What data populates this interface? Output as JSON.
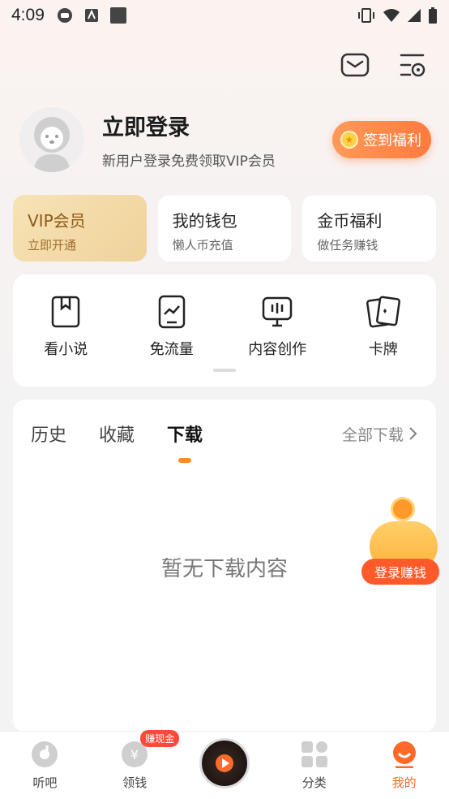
{
  "status": {
    "time": "4:09"
  },
  "profile": {
    "title": "立即登录",
    "subtitle": "新用户登录免费领取VIP会员",
    "checkin_label": "签到福利"
  },
  "cards": [
    {
      "title": "VIP会员",
      "sub": "立即开通"
    },
    {
      "title": "我的钱包",
      "sub": "懒人币充值"
    },
    {
      "title": "金币福利",
      "sub": "做任务赚钱"
    }
  ],
  "tools": [
    {
      "label": "看小说"
    },
    {
      "label": "免流量"
    },
    {
      "label": "内容创作"
    },
    {
      "label": "卡牌"
    }
  ],
  "history": {
    "tabs": [
      "历史",
      "收藏",
      "下载"
    ],
    "active_tab": "下载",
    "all_label": "全部下载",
    "empty_text": "暂无下载内容"
  },
  "promo": {
    "label": "登录赚钱"
  },
  "nav": {
    "items": [
      {
        "label": "听吧"
      },
      {
        "label": "领钱",
        "badge": "赚现金"
      },
      {
        "label": ""
      },
      {
        "label": "分类"
      },
      {
        "label": "我的"
      }
    ]
  },
  "colors": {
    "accent": "#ff6a2a",
    "vip_bg": "#f7e3b6",
    "badge": "#ff4a3a"
  }
}
